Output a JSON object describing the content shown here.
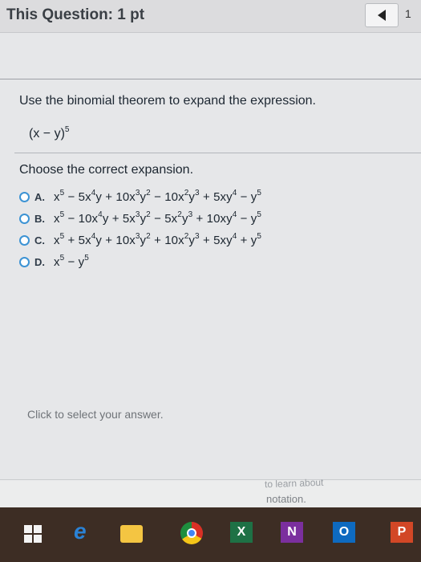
{
  "header": {
    "title": "This Question: 1 pt",
    "count": "1"
  },
  "question": {
    "prompt": "Use the binomial theorem to expand the expression.",
    "expression": {
      "base": "(x − y)",
      "exp": "5"
    },
    "instruction": "Choose the correct expansion."
  },
  "choices": [
    {
      "letter": "A.",
      "expression": "x^5 − 5x^4y + 10x^3y^2 − 10x^2y^3 + 5xy^4 − y^5"
    },
    {
      "letter": "B.",
      "expression": "x^5 − 10x^4y + 5x^3y^2 − 5x^2y^3 + 10xy^4 − y^5"
    },
    {
      "letter": "C.",
      "expression": "x^5 + 5x^4y + 10x^3y^2 + 10x^2y^3 + 5xy^4 + y^5"
    },
    {
      "letter": "D.",
      "expression": "x^5 − y^5"
    }
  ],
  "hint": "Click to select your answer.",
  "bottom": {
    "notation": "notation.",
    "tooltip": "to learn about"
  },
  "taskbar": {
    "icons": [
      "windows-start-icon",
      "edge-icon",
      "file-explorer-icon",
      "chrome-icon",
      "excel-icon",
      "onenote-icon",
      "outlook-icon",
      "powerpoint-icon"
    ],
    "labels": {
      "excel": "X",
      "onenote": "N",
      "outlook": "O",
      "powerpoint": "P"
    }
  },
  "colors": {
    "radio": "#3c93d4",
    "taskbar": "#3d2d24"
  }
}
